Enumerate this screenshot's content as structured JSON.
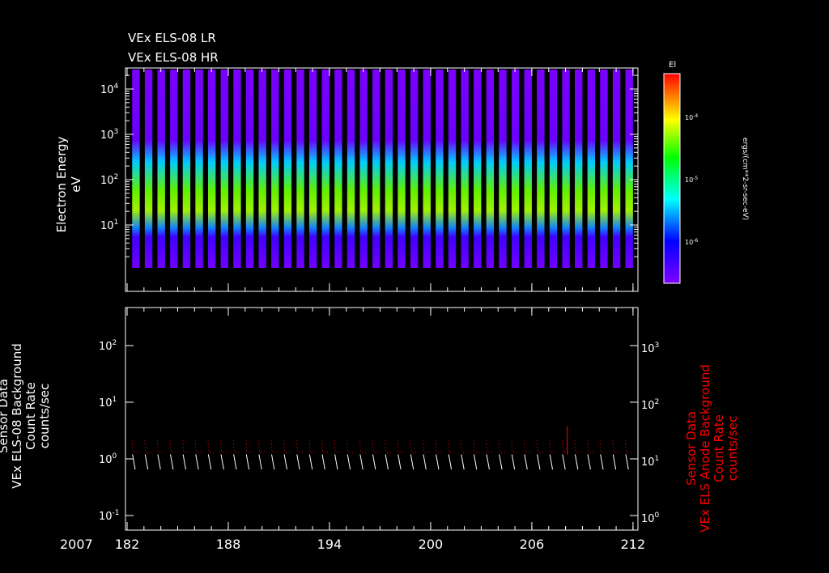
{
  "titles": [
    "VEx ELS-08 LR",
    "VEx ELS-08 HR"
  ],
  "chart_data": [
    {
      "type": "heatmap",
      "title": "VEx ELS-08 LR / HR",
      "ylabel": [
        "Electron Energy",
        "eV"
      ],
      "yscale": "log",
      "ylim": [
        0.35,
        29000
      ],
      "xlim": [
        182,
        212.3
      ],
      "yticks": [
        {
          "v": 10,
          "l": "10",
          "e": "1"
        },
        {
          "v": 100,
          "l": "10",
          "e": "2"
        },
        {
          "v": 1000,
          "l": "10",
          "e": "3"
        },
        {
          "v": 10000,
          "l": "10",
          "e": "4"
        }
      ],
      "orbit_starts": [
        182.3,
        183.05,
        183.8,
        184.55,
        185.3,
        186.05,
        186.8,
        187.55,
        188.3,
        189.05,
        189.8,
        190.55,
        191.3,
        192.05,
        192.8,
        193.55,
        194.3,
        195.05,
        195.8,
        196.55,
        197.3,
        198.05,
        198.8,
        199.55,
        200.3,
        201.05,
        201.8,
        202.55,
        203.3,
        204.05,
        204.8,
        205.55,
        206.3,
        207.05,
        207.8,
        208.55,
        209.3,
        210.05,
        210.8,
        211.55
      ],
      "colorbar": {
        "label": "El",
        "units": "ergs/(cm**2-sr-sec-eV)",
        "ticks": [
          {
            "l": "10",
            "e": "-4"
          },
          {
            "l": "10",
            "e": "-5"
          },
          {
            "l": "10",
            "e": "-6"
          }
        ]
      }
    },
    {
      "type": "line",
      "ylabel_left": [
        "Sensor Data",
        "VEx ELS-08 Background",
        "Count Rate",
        "counts/sec"
      ],
      "ylabel_right": [
        "Sensor Data",
        "VEx ELS Anode Background",
        "Count Rate",
        "counts/sec"
      ],
      "yscale": "log",
      "ylim_left": [
        0.055,
        470
      ],
      "ylim_right": [
        0.55,
        4700
      ],
      "yticks_left": [
        {
          "l": "10",
          "e": "-1"
        },
        {
          "l": "10",
          "e": "0"
        },
        {
          "l": "10",
          "e": "1"
        },
        {
          "l": "10",
          "e": "2"
        }
      ],
      "yticks_right": [
        {
          "l": "10",
          "e": "0"
        },
        {
          "l": "10",
          "e": "1"
        },
        {
          "l": "10",
          "e": "2"
        },
        {
          "l": "10",
          "e": "3"
        }
      ],
      "series": [
        {
          "name": "ELS-08 background",
          "color": "#ffffff",
          "orbit_range": [
            1.2,
            0.65
          ]
        },
        {
          "name": "Anode background",
          "color": "#ff0000",
          "orbit_range": [
            2.1,
            1.3
          ]
        }
      ],
      "peak": {
        "x": 208.1,
        "y": 3.8
      },
      "xaxis": {
        "year": "2007",
        "ticks": [
          "182",
          "188",
          "194",
          "200",
          "206",
          "212"
        ],
        "values": [
          182,
          188,
          194,
          200,
          206,
          212
        ]
      }
    }
  ]
}
